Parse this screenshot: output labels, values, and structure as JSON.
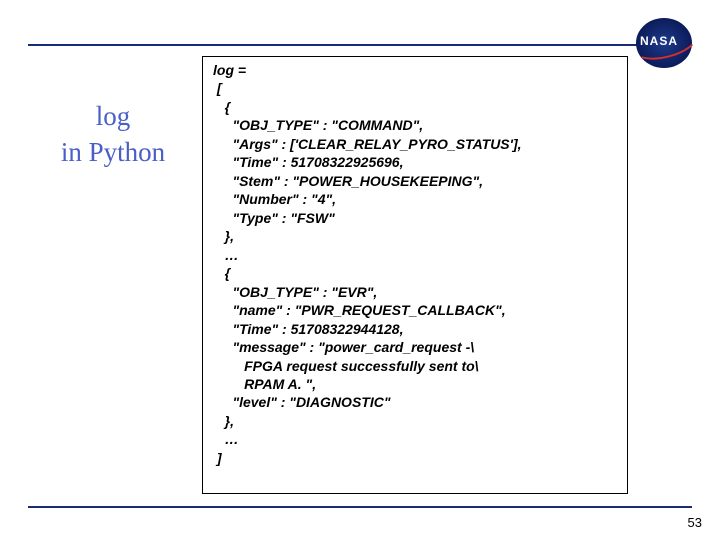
{
  "logo": {
    "label": "NASA"
  },
  "title": {
    "line1": "log",
    "line2": "in Python"
  },
  "code": "log =\n [\n   {\n     \"OBJ_TYPE\" : \"COMMAND\",\n     \"Args\" : ['CLEAR_RELAY_PYRO_STATUS'],\n     \"Time\" : 51708322925696,\n     \"Stem\" : \"POWER_HOUSEKEEPING\",\n     \"Number\" : \"4\",\n     \"Type\" : \"FSW\"\n   },\n   …\n   {\n     \"OBJ_TYPE\" : \"EVR\",\n     \"name\" : \"PWR_REQUEST_CALLBACK\",\n     \"Time\" : 51708322944128,\n     \"message\" : \"power_card_request -\\\n        FPGA request successfully sent to\\\n        RPAM A. \",\n     \"level\" : \"DIAGNOSTIC\"\n   },\n   …\n ]",
  "page_number": "53"
}
